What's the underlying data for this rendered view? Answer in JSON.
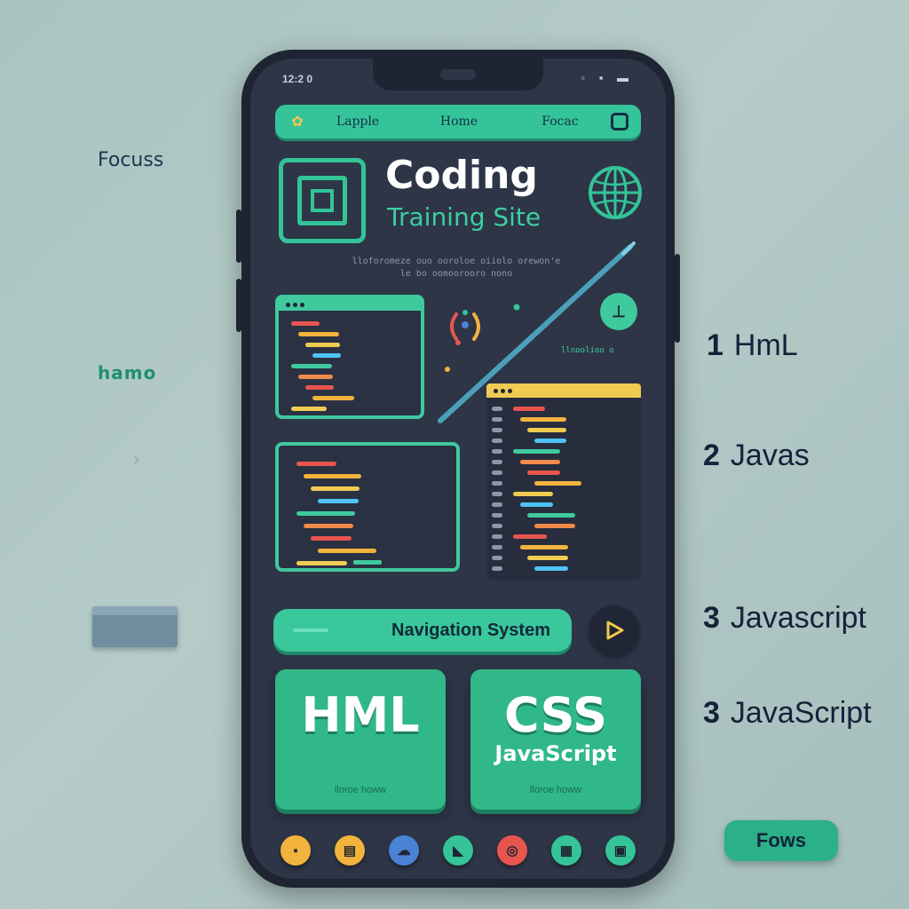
{
  "side": {
    "focus_label": "Focuss",
    "hamo_label": "hamo",
    "list": [
      {
        "num": "1",
        "text": "HmL"
      },
      {
        "num": "2",
        "text": "Javas"
      },
      {
        "num": "3",
        "text": "Javascript"
      },
      {
        "num": "3",
        "text": "JavaScript"
      }
    ],
    "focus_button": "Fows"
  },
  "phone": {
    "status_left": "12:2 0",
    "status_right": "◦ ▪ ▬",
    "nav": {
      "icon": "gear-icon",
      "links": [
        "Lapple",
        "Home",
        "Focac"
      ]
    },
    "title": "Coding",
    "subtitle": "Training Site",
    "tagline": "lloforomeze ouo ooroloe oiiolo orewon'e le bo oomoorooro nono",
    "small_label": "llnoolioo o",
    "nav_system_label": "Navigation System",
    "cards": [
      {
        "big": "HML",
        "sub": "",
        "note": "lloroe howw"
      },
      {
        "big": "CSS",
        "sub": "JavaScript",
        "note": "lloroe howw"
      }
    ],
    "dock": [
      {
        "icon": "folder-icon",
        "color": "#f2b33d"
      },
      {
        "icon": "notes-icon",
        "color": "#f2b33d"
      },
      {
        "icon": "cloud-icon",
        "color": "#4a82d6"
      },
      {
        "icon": "chat-icon",
        "color": "#34c497"
      },
      {
        "icon": "browser-icon",
        "color": "#e8554e"
      },
      {
        "icon": "grid-icon",
        "color": "#34c497"
      },
      {
        "icon": "book-icon",
        "color": "#34c497"
      }
    ]
  },
  "colors": {
    "accent": "#34c497",
    "background": "#a9c4c1",
    "phone_body": "#1f2432",
    "screen": "#2d3547"
  }
}
